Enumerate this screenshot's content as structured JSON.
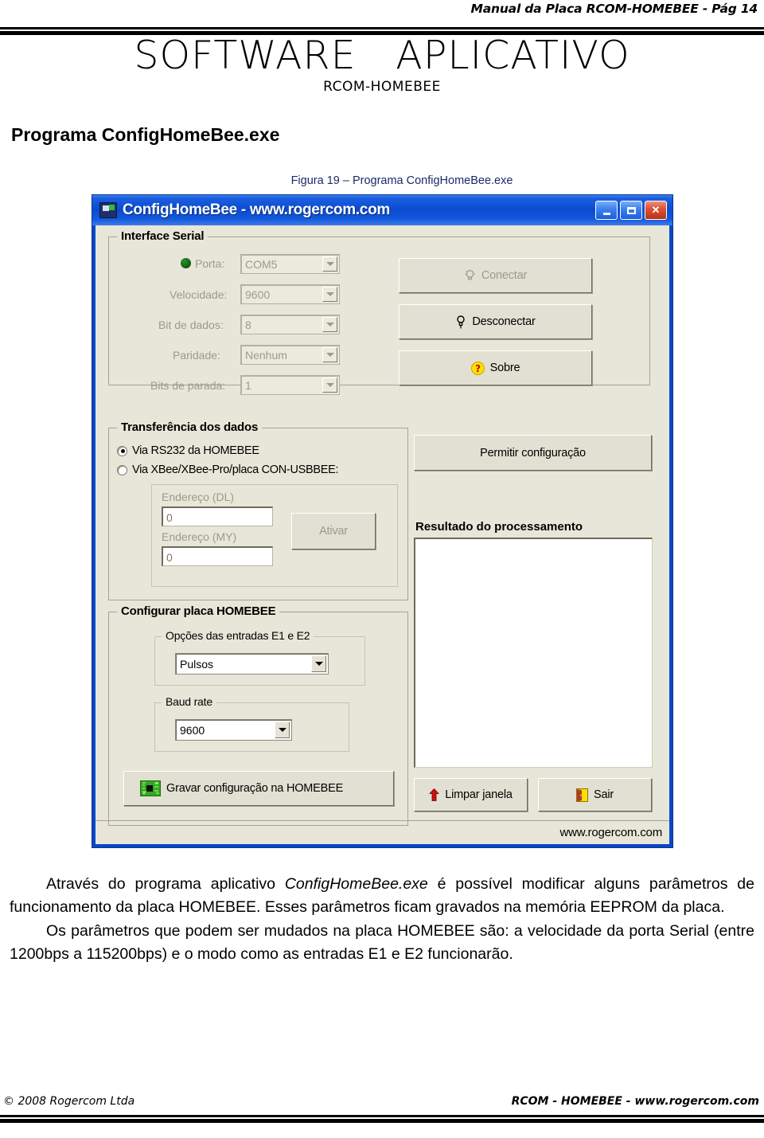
{
  "page": {
    "header_text": "Manual da Placa RCOM-HOMEBEE  -  Pág 14",
    "main_title": "SOFTWARE   APLICATIVO",
    "sub_title": "RCOM-HOMEBEE",
    "section_heading": "Programa ConfigHomeBee.exe",
    "figure_caption": "Figura 19 – Programa  ConfigHomeBee.exe"
  },
  "window": {
    "title": "ConfigHomeBee - www.rogercom.com",
    "icon": "app-board-icon",
    "buttons": {
      "minimize": "minimize-icon",
      "maximize": "maximize-icon",
      "close": "close-icon"
    },
    "status_text": "www.rogercom.com"
  },
  "serial_group": {
    "title": "Interface Serial",
    "led_color": "#1a7a1c",
    "fields": [
      {
        "label": "Porta:",
        "value": "COM5",
        "enabled": false
      },
      {
        "label": "Velocidade:",
        "value": "9600",
        "enabled": false
      },
      {
        "label": "Bit de dados:",
        "value": "8",
        "enabled": false
      },
      {
        "label": "Paridade:",
        "value": "Nenhum",
        "enabled": false
      },
      {
        "label": "Bits de parada:",
        "value": "1",
        "enabled": false
      }
    ],
    "buttons": [
      {
        "label": "Conectar",
        "icon": "lamp-off-icon",
        "enabled": false
      },
      {
        "label": "Desconectar",
        "icon": "lamp-on-icon",
        "enabled": true
      },
      {
        "label": "Sobre",
        "icon": "help-icon",
        "enabled": true
      }
    ]
  },
  "transfer_group": {
    "title": "Transferência dos dados",
    "radios": [
      {
        "label": "Via RS232 da HOMEBEE",
        "selected": true
      },
      {
        "label": "Via XBee/XBee-Pro/placa CON-USBBEE:",
        "selected": false
      }
    ],
    "address_dl_label": "Endereço (DL)",
    "address_dl_value": "0",
    "address_my_label": "Endereço (MY)",
    "address_my_value": "0",
    "activate_label": "Ativar",
    "activate_enabled": false
  },
  "config_group": {
    "title": "Configurar placa HOMEBEE",
    "inputs_group_title": "Opções das entradas E1 e E2",
    "inputs_value": "Pulsos",
    "baud_group_title": "Baud rate",
    "baud_value": "9600",
    "write_button_label": "Gravar configuração na HOMEBEE",
    "write_button_icon": "pcb-chip-icon"
  },
  "right_panel": {
    "permit_button_label": "Permitir configuração",
    "result_label": "Resultado do processamento",
    "result_value": "",
    "clear_button_label": "Limpar janela",
    "clear_button_icon": "red-up-arrow-icon",
    "exit_button_label": "Sair",
    "exit_button_icon": "exit-door-icon"
  },
  "body": {
    "p1_a": "Através do programa aplicativo ",
    "p1_i": "ConfigHomeBee.exe",
    "p1_b": " é possível modificar alguns parâmetros de funcionamento da placa HOMEBEE. Esses parâmetros ficam gravados na memória EEPROM da placa.",
    "p2": "Os parâmetros que podem ser mudados na placa HOMEBEE são: a velocidade da porta Serial (entre 1200bps a 115200bps) e o modo como as entradas E1 e E2 funcionarão."
  },
  "footer": {
    "left": "© 2008 Rogercom Ltda",
    "right": "RCOM - HOMEBEE - www.rogercom.com"
  }
}
